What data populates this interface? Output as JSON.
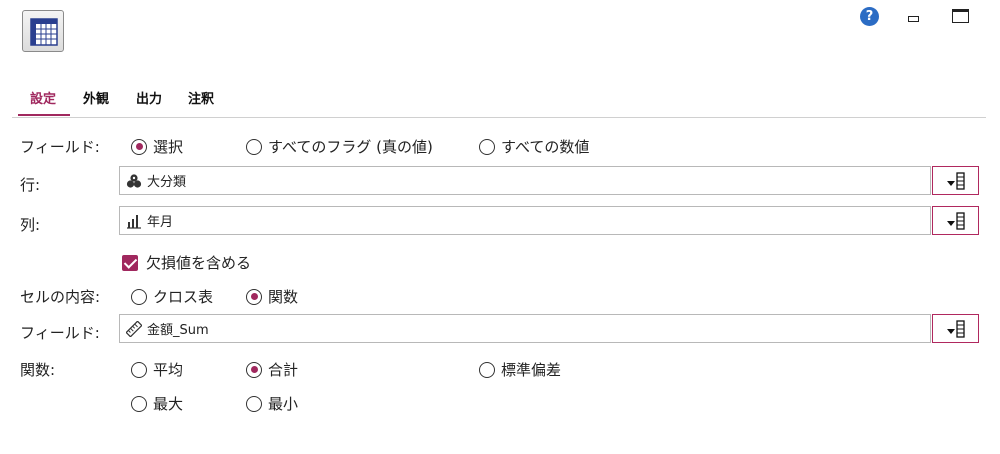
{
  "window": {
    "help_glyph": "?"
  },
  "tabs": [
    {
      "label": "設定",
      "active": true
    },
    {
      "label": "外観",
      "active": false
    },
    {
      "label": "出力",
      "active": false
    },
    {
      "label": "注釈",
      "active": false
    }
  ],
  "fields_mode": {
    "label": "フィールド:",
    "options": [
      {
        "label": "選択",
        "selected": true
      },
      {
        "label": "すべてのフラグ (真の値)",
        "selected": false
      },
      {
        "label": "すべての数値",
        "selected": false
      }
    ]
  },
  "row": {
    "label": "行:",
    "value": "大分類",
    "icon": "nominal-set-icon"
  },
  "column": {
    "label": "列:",
    "value": "年月",
    "icon": "ordinal-bars-icon"
  },
  "include_missing": {
    "label": "欠損値を含める",
    "checked": true
  },
  "cell_contents": {
    "label": "セルの内容:",
    "options": [
      {
        "label": "クロス表",
        "selected": false
      },
      {
        "label": "関数",
        "selected": true
      }
    ]
  },
  "cell_field": {
    "label": "フィールド:",
    "value": "金額_Sum",
    "icon": "continuous-ruler-icon"
  },
  "function": {
    "label": "関数:",
    "options": [
      {
        "label": "平均",
        "selected": false
      },
      {
        "label": "合計",
        "selected": true
      },
      {
        "label": "標準偏差",
        "selected": false
      },
      {
        "label": "最大",
        "selected": false
      },
      {
        "label": "最小",
        "selected": false
      }
    ]
  },
  "colors": {
    "accent": "#a0285e",
    "help_blue": "#2b6cc4"
  }
}
